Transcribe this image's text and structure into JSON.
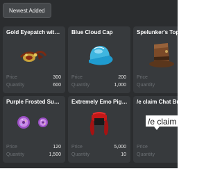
{
  "filter": {
    "label": "Newest Added"
  },
  "price_label": "Price",
  "quantity_label": "Quantity",
  "items": [
    {
      "name": "Gold Eyepatch with ...",
      "price": "300",
      "quantity": "600",
      "icon": "gold-eyepatch-icon"
    },
    {
      "name": "Blue Cloud Cap",
      "price": "200",
      "quantity": "1,000",
      "icon": "blue-cap-icon"
    },
    {
      "name": "Spelunker's Top Hat",
      "price": "",
      "quantity": "",
      "icon": "top-hat-icon"
    },
    {
      "name": "Purple Frosted Sugar...",
      "price": "120",
      "quantity": "1,500",
      "icon": "purple-donut-icon"
    },
    {
      "name": "Extremely Emo Pigtails",
      "price": "5,000",
      "quantity": "10",
      "icon": "red-pigtails-icon"
    },
    {
      "name": "/e claim Chat Bubble",
      "price": "",
      "quantity": "",
      "icon": "chat-bubble-icon",
      "bubble_text": "/e claim"
    }
  ],
  "colors": {
    "background": "#2b2d2f",
    "card": "#373a3d",
    "label": "#6c7074"
  }
}
